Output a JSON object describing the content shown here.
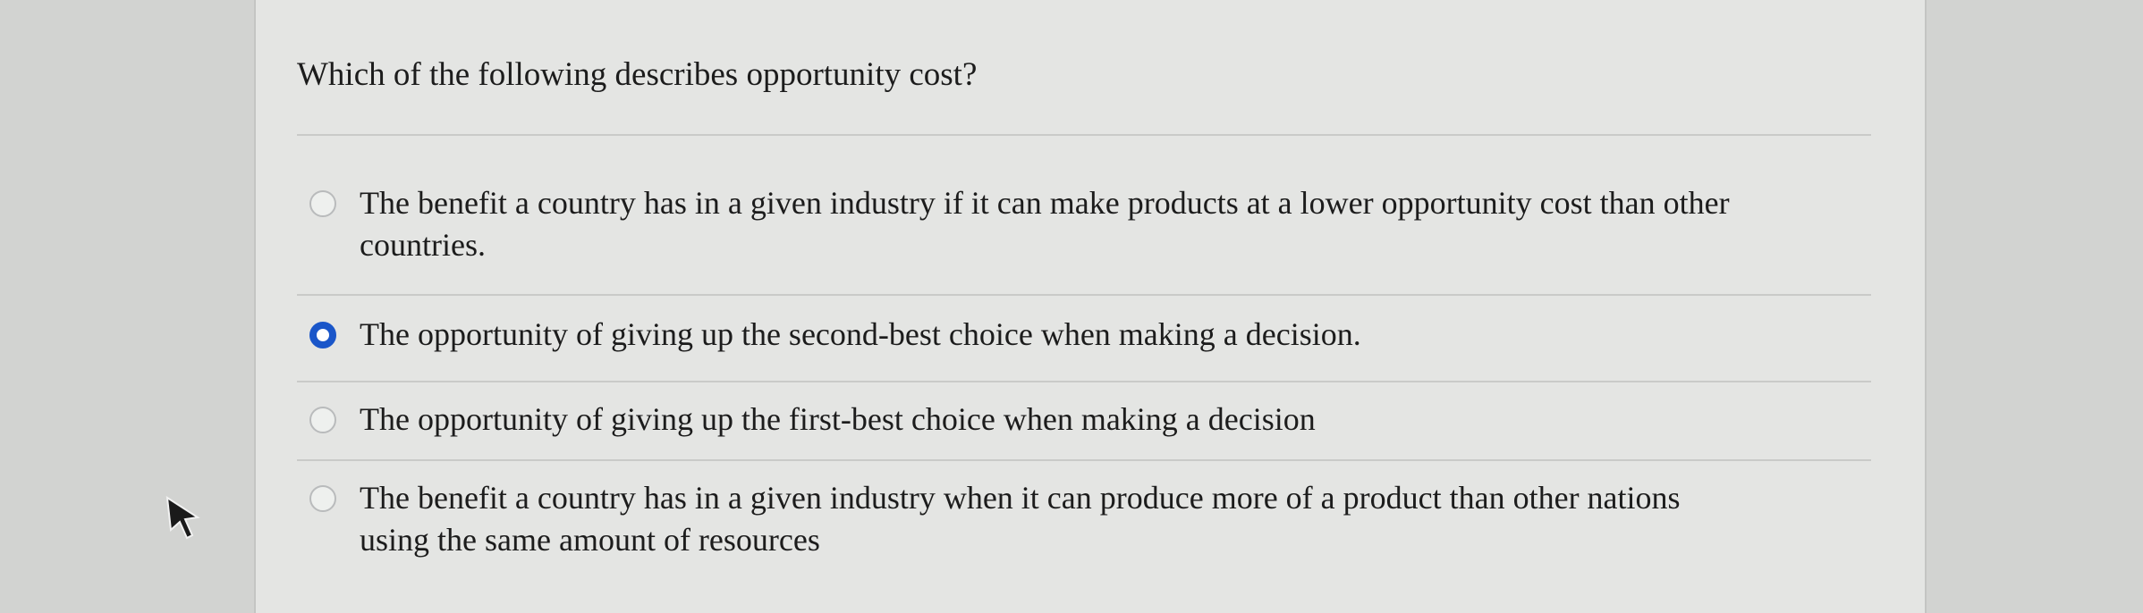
{
  "question": {
    "text": "Which of the following describes opportunity cost?"
  },
  "options": [
    {
      "label_line1": "The benefit a country has in a given industry if it can make products at a lower opportunity cost than other",
      "label_line2": "countries.",
      "selected": false
    },
    {
      "label_line1": "The opportunity of giving up the second-best choice when making a decision.",
      "selected": true
    },
    {
      "label_line1": "The opportunity of giving up the first-best choice when making a decision",
      "selected": false
    },
    {
      "label_line1": "The benefit a country has in a given industry when it can produce more of a product than other nations",
      "label_line2": "using the same amount of resources",
      "selected": false
    }
  ],
  "colors": {
    "selected_radio": "#1a56c9",
    "page_background": "#e4e5e3"
  },
  "icons": {
    "cursor": "mouse-pointer-arrow-icon"
  }
}
